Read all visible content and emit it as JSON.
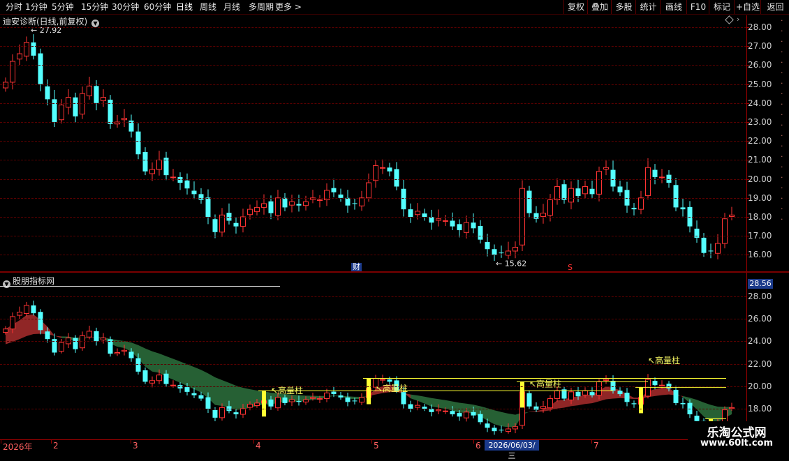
{
  "toolbar": {
    "periods": [
      "分时",
      "1分钟",
      "5分钟",
      "15分钟",
      "30分钟",
      "60分钟",
      "日线",
      "周线",
      "月线",
      "多周期",
      "更多 >"
    ],
    "active": "日线",
    "right_buttons": [
      "复权",
      "叠加",
      "多股",
      "统计",
      "画线",
      "F10",
      "标记",
      "+自选",
      "返回"
    ]
  },
  "main_pane": {
    "title": "迪安诊断(日线,前复权)",
    "high_label": "27.92",
    "low_label": "15.62",
    "finance_mark": "财",
    "s_mark": "S",
    "y_ticks": [
      "28.00",
      "27.00",
      "26.00",
      "25.00",
      "24.00",
      "23.00",
      "22.00",
      "21.00",
      "20.00",
      "19.00",
      "18.00",
      "17.00",
      "16.00"
    ]
  },
  "indicator_pane": {
    "title": "股朋指标网",
    "current_value": "28.56",
    "y_ticks": [
      "28.00",
      "26.00",
      "24.00",
      "22.00",
      "20.00",
      "18.00"
    ],
    "annotations": [
      "高量柱",
      "高量柱",
      "高量柱",
      "高量柱"
    ]
  },
  "x_axis": {
    "labels": [
      "2026年",
      "2",
      "3",
      "4",
      "5",
      "6",
      "7"
    ],
    "cursor_date": "2026/06/03/三"
  },
  "watermark": {
    "line1": "乐淘公式网",
    "line2": "www.60lt.com"
  },
  "colors": {
    "up": "#ff3333",
    "down": "#54ffff",
    "cloud_bear": "#a02a2a",
    "cloud_bull": "#2a6a3a",
    "volume_pillar": "#ffff33"
  },
  "chart_data": {
    "type": "candlestick",
    "closes": [
      25.1,
      26.2,
      26.6,
      27.2,
      26.5,
      25.0,
      24.2,
      23.0,
      23.9,
      24.3,
      23.3,
      24.5,
      24.9,
      24.0,
      24.3,
      22.9,
      23.0,
      23.2,
      22.5,
      21.3,
      20.4,
      20.5,
      21.0,
      20.2,
      20.1,
      19.8,
      19.5,
      19.2,
      18.9,
      18.0,
      17.2,
      18.1,
      17.8,
      17.5,
      18.0,
      18.4,
      18.5,
      18.7,
      18.2,
      19.0,
      18.5,
      18.8,
      18.6,
      18.8,
      19.0,
      18.9,
      19.4,
      19.3,
      19.0,
      18.6,
      18.7,
      19.0,
      19.8,
      20.7,
      20.6,
      20.4,
      19.6,
      18.4,
      18.0,
      18.3,
      18.0,
      17.7,
      17.9,
      17.8,
      17.5,
      17.3,
      17.7,
      17.4,
      16.8,
      16.3,
      16.0,
      16.1,
      16.2,
      16.4,
      19.5,
      18.2,
      17.9,
      18.2,
      18.9,
      19.6,
      18.9,
      19.5,
      19.1,
      19.6,
      19.2,
      20.4,
      20.6,
      19.6,
      19.3,
      18.6,
      18.4,
      19.0,
      20.6,
      20.1,
      20.1,
      19.8,
      18.5,
      18.4,
      17.5,
      16.9,
      16.1,
      16.2,
      16.6,
      17.9,
      18.1
    ],
    "high_label_value": 27.92,
    "low_label_value": 15.62,
    "ylim": [
      15.5,
      28.3
    ]
  }
}
